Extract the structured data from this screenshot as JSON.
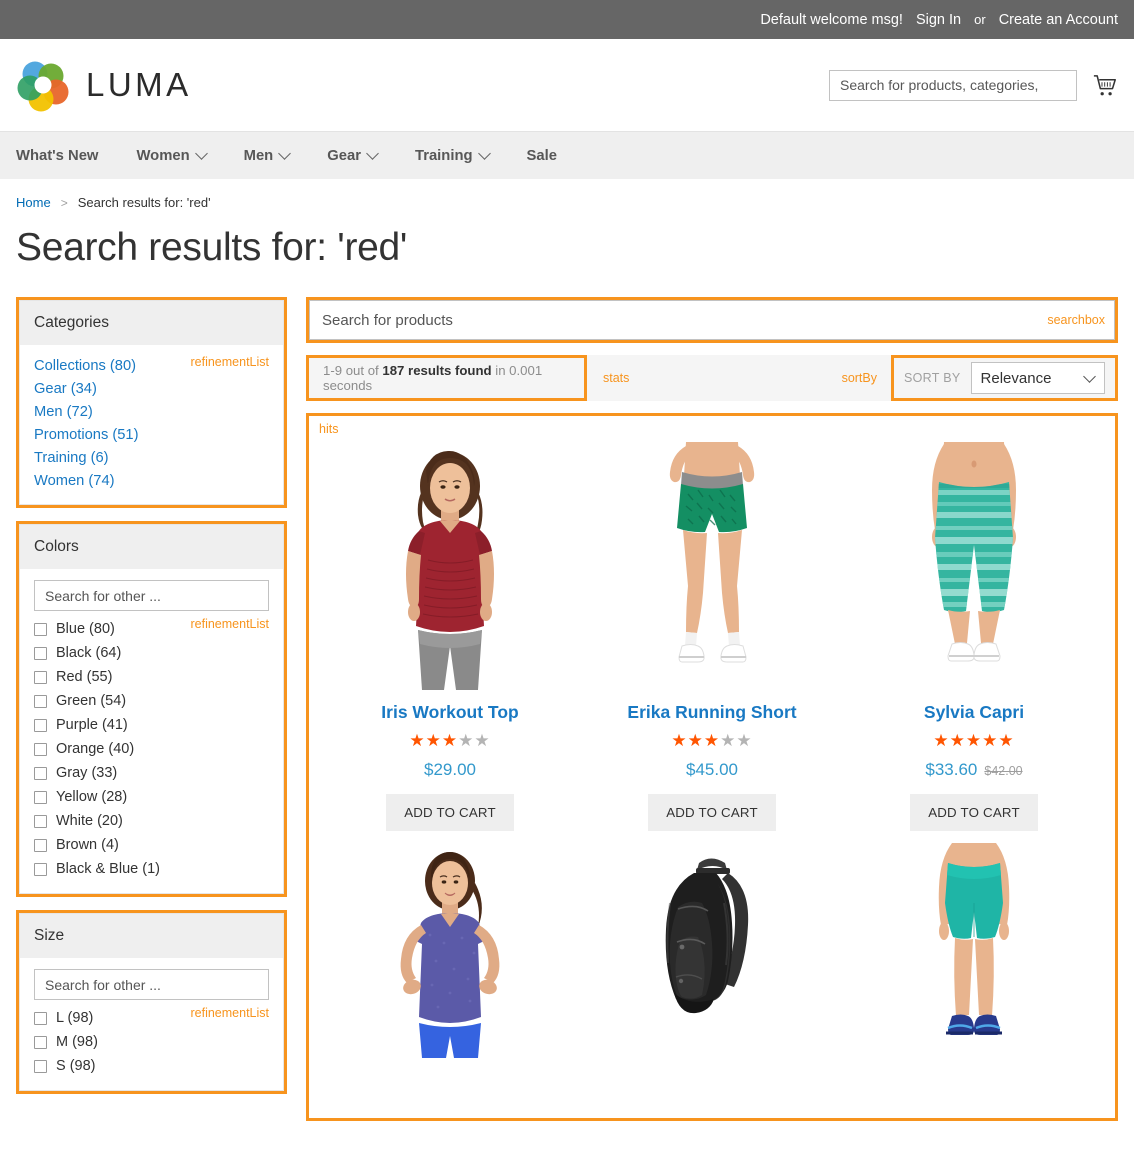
{
  "topbar": {
    "welcome": "Default welcome msg!",
    "sign_in": "Sign In",
    "or": "or",
    "create_account": "Create an Account"
  },
  "header": {
    "logo_text": "LUMA",
    "logo_icon": "luma-flower-icon",
    "search_placeholder": "Search for products, categories,",
    "search_value": "",
    "cart_icon": "shopping-cart-icon"
  },
  "nav": {
    "items": [
      {
        "label": "What's New",
        "has_chevron": false
      },
      {
        "label": "Women",
        "has_chevron": true
      },
      {
        "label": "Men",
        "has_chevron": true
      },
      {
        "label": "Gear",
        "has_chevron": true
      },
      {
        "label": "Training",
        "has_chevron": true
      },
      {
        "label": "Sale",
        "has_chevron": false
      }
    ]
  },
  "breadcrumb": {
    "home": "Home",
    "separator": ">",
    "current": "Search results for: 'red'"
  },
  "page_title": "Search results for: 'red'",
  "sidebar": {
    "categories": {
      "title": "Categories",
      "widget_label": "refinementList",
      "items": [
        {
          "label": "Collections (80)"
        },
        {
          "label": "Gear (34)"
        },
        {
          "label": "Men (72)"
        },
        {
          "label": "Promotions (51)"
        },
        {
          "label": "Training (6)"
        },
        {
          "label": "Women (74)"
        }
      ]
    },
    "colors": {
      "title": "Colors",
      "widget_label": "refinementList",
      "search_placeholder": "Search for other ...",
      "search_value": "",
      "items": [
        {
          "label": "Blue (80)",
          "checked": false
        },
        {
          "label": "Black (64)",
          "checked": false
        },
        {
          "label": "Red (55)",
          "checked": false
        },
        {
          "label": "Green (54)",
          "checked": false
        },
        {
          "label": "Purple (41)",
          "checked": false
        },
        {
          "label": "Orange (40)",
          "checked": false
        },
        {
          "label": "Gray (33)",
          "checked": false
        },
        {
          "label": "Yellow (28)",
          "checked": false
        },
        {
          "label": "White (20)",
          "checked": false
        },
        {
          "label": "Brown (4)",
          "checked": false
        },
        {
          "label": "Black & Blue (1)",
          "checked": false
        }
      ]
    },
    "size": {
      "title": "Size",
      "widget_label": "refinementList",
      "search_placeholder": "Search for other ...",
      "search_value": "",
      "items": [
        {
          "label": "L (98)",
          "checked": false
        },
        {
          "label": "M (98)",
          "checked": false
        },
        {
          "label": "S (98)",
          "checked": false
        }
      ]
    }
  },
  "results": {
    "searchbox": {
      "placeholder": "Search for products",
      "value": "",
      "widget_label": "searchbox"
    },
    "stats": {
      "prefix": "1-9 out of ",
      "found": "187 results found",
      "suffix": " in 0.001 seconds",
      "widget_label": "stats"
    },
    "sortby": {
      "widget_label": "sortBy",
      "label": "SORT BY",
      "selected": "Relevance",
      "options": [
        "Relevance"
      ]
    },
    "hits": {
      "widget_label": "hits",
      "add_to_cart_label": "ADD TO CART",
      "items": [
        {
          "name": "Iris Workout Top",
          "rating": 3,
          "max_rating": 5,
          "price": "$29.00",
          "old_price": "",
          "image": "woman-red-workout-top"
        },
        {
          "name": "Erika Running Short",
          "rating": 3,
          "max_rating": 5,
          "price": "$45.00",
          "old_price": "",
          "image": "woman-green-running-short"
        },
        {
          "name": "Sylvia Capri",
          "rating": 5,
          "max_rating": 5,
          "price": "$33.60",
          "old_price": "$42.00",
          "image": "woman-teal-striped-capri"
        },
        {
          "name": "",
          "rating": 0,
          "max_rating": 5,
          "price": "",
          "old_price": "",
          "image": "woman-purple-tee"
        },
        {
          "name": "",
          "rating": 0,
          "max_rating": 5,
          "price": "",
          "old_price": "",
          "image": "black-backpack"
        },
        {
          "name": "",
          "rating": 0,
          "max_rating": 5,
          "price": "",
          "old_price": "",
          "image": "woman-teal-bike-short"
        }
      ]
    }
  },
  "colors": {
    "annotation_orange": "#f7941e",
    "link_blue": "#1979c3",
    "price_blue": "#3399cc",
    "star_orange": "#ff5501",
    "topbar_gray": "#666666",
    "nav_gray": "#efefef"
  }
}
